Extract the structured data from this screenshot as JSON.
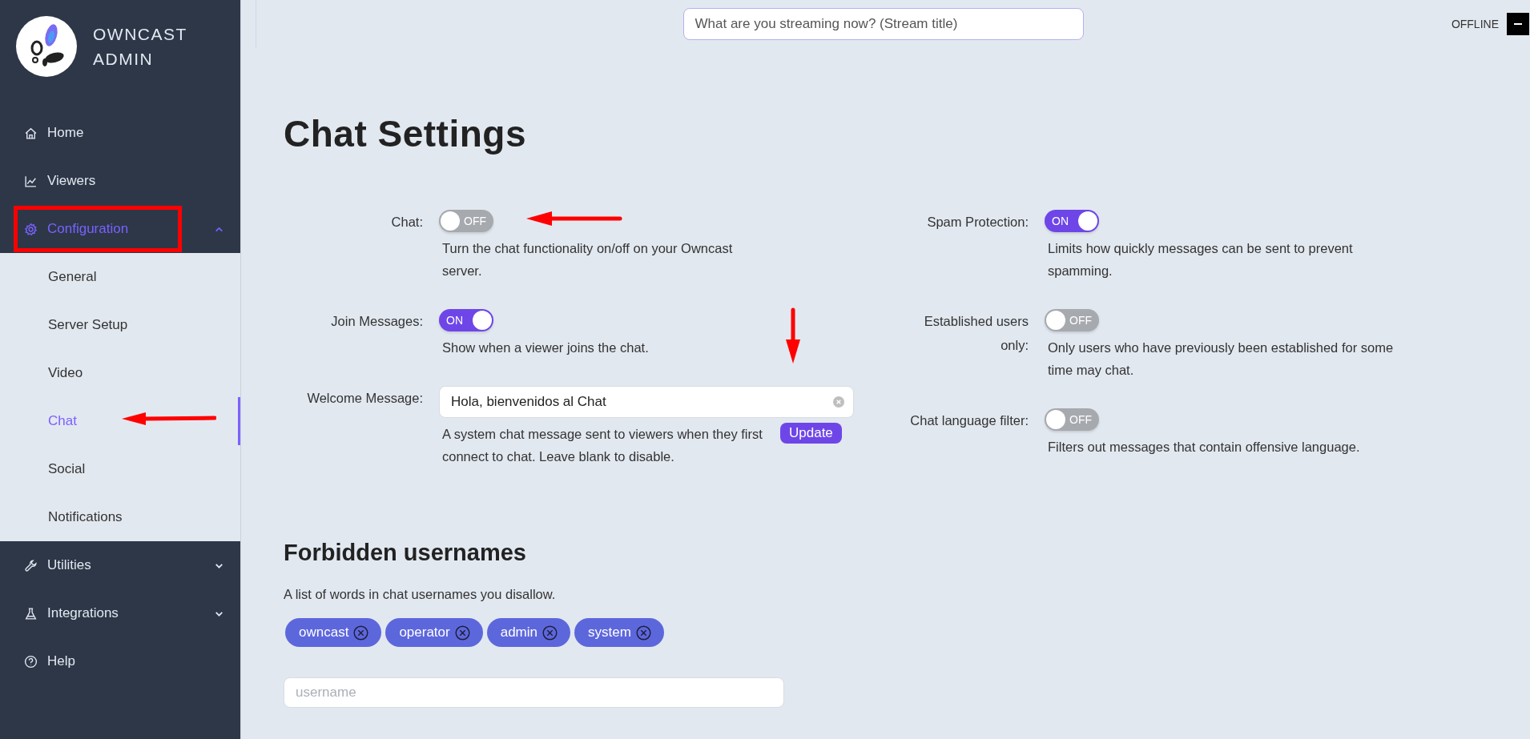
{
  "sidebar": {
    "brand": "OWNCAST ADMIN",
    "items": [
      {
        "label": "Home",
        "kind": "link",
        "selected": false
      },
      {
        "label": "Viewers",
        "kind": "link",
        "selected": false
      },
      {
        "label": "Configuration",
        "kind": "group",
        "selected": true,
        "expanded": true,
        "children": [
          {
            "label": "General",
            "selected": false
          },
          {
            "label": "Server Setup",
            "selected": false
          },
          {
            "label": "Video",
            "selected": false
          },
          {
            "label": "Chat",
            "selected": true
          },
          {
            "label": "Social",
            "selected": false
          },
          {
            "label": "Notifications",
            "selected": false
          }
        ]
      },
      {
        "label": "Utilities",
        "kind": "group",
        "selected": false,
        "expanded": false
      },
      {
        "label": "Integrations",
        "kind": "group",
        "selected": false,
        "expanded": false
      },
      {
        "label": "Help",
        "kind": "link",
        "selected": false
      }
    ]
  },
  "topbar": {
    "stream_title": {
      "placeholder": "What are you streaming now? (Stream title)"
    },
    "status": "OFFLINE"
  },
  "page_title": "Chat Settings",
  "settings_left": [
    {
      "kind": "toggle",
      "label": "Chat:",
      "on": false,
      "state_label": "OFF",
      "description": "Turn the chat functionality on/off on your Owncast server."
    },
    {
      "kind": "toggle",
      "label": "Join Messages:",
      "on": true,
      "state_label": "ON",
      "description": "Show when a viewer joins the chat."
    },
    {
      "kind": "text",
      "label": "Welcome Message:",
      "value": "Hola, bienvenidos al Chat",
      "button": "Update",
      "description": "A system chat message sent to viewers when they first connect to chat. Leave blank to disable."
    }
  ],
  "settings_right": [
    {
      "kind": "toggle",
      "label": "Spam Protection:",
      "on": true,
      "state_label": "ON",
      "description": "Limits how quickly messages can be sent to prevent spamming."
    },
    {
      "kind": "toggle",
      "label": "Established users only:",
      "on": false,
      "state_label": "OFF",
      "description": "Only users who have previously been established for some time may chat."
    },
    {
      "kind": "toggle",
      "label": "Chat language filter:",
      "on": false,
      "state_label": "OFF",
      "description": "Filters out messages that contain offensive language."
    }
  ],
  "forbidden": {
    "heading": "Forbidden usernames",
    "description": "A list of words in chat usernames you disallow.",
    "tags": [
      "owncast",
      "operator",
      "admin",
      "system"
    ],
    "input": {
      "placeholder": "username"
    }
  }
}
